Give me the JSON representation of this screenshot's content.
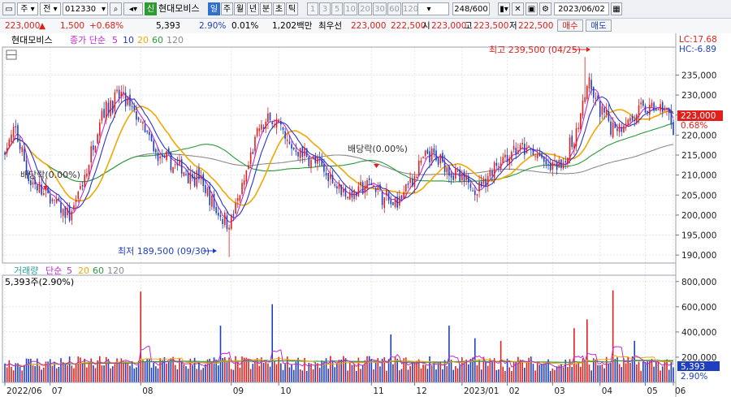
{
  "toolbar": {
    "market": "주",
    "mode": "전",
    "code": "012330",
    "type_badge": "신",
    "name": "현대모비스",
    "periods": [
      "일",
      "주",
      "월",
      "년",
      "분",
      "초",
      "틱"
    ],
    "active_period": "일",
    "intervals": [
      "1",
      "3",
      "5",
      "10",
      "20",
      "30",
      "60",
      "120"
    ],
    "count": "248",
    "count_max": "/600",
    "date": "2023/06/02"
  },
  "quote": {
    "price": "223,000",
    "arrow": "▲",
    "change": "1,500",
    "change_pct": "+0.68%",
    "volume": "5,393",
    "turnover": "2.90%",
    "ratio": "0.01%",
    "amount": "1,202백만",
    "best_label": "최우선",
    "best_ask": "223,000",
    "best_bid": "222,500",
    "open_label": "시",
    "open": "223,000",
    "high_label": "고",
    "high": "223,500",
    "low_label": "저",
    "low": "222,500",
    "buy_btn": "매수",
    "sell_btn": "매도"
  },
  "legend": {
    "name": "현대모비스",
    "ma_label": "종가 단순",
    "ma_periods": [
      "5",
      "10",
      "20",
      "60",
      "120"
    ],
    "vol_label": "거래량",
    "vol_ma_label": "단순",
    "vol_ma_periods": [
      "5",
      "20",
      "60",
      "120"
    ],
    "vol_current": "5,393주(2.90%)"
  },
  "colors": {
    "up": "#e0201c",
    "down": "#1f3fbf",
    "ma5": "#c02bd0",
    "ma10": "#2a34c8",
    "ma20": "#f0a800",
    "ma60": "#2a9a3a",
    "ma120": "#8c8c8c"
  },
  "chart_data": {
    "type": "candlestick",
    "price_axis": {
      "ticks": [
        "235,000",
        "230,000",
        "225,000",
        "220,000",
        "215,000",
        "210,000",
        "205,000",
        "200,000",
        "195,000",
        "190,000"
      ],
      "ylim": [
        188000,
        242000
      ]
    },
    "volume_axis": {
      "ticks": [
        "800,000",
        "600,000",
        "400,000",
        "200,000"
      ],
      "ylim": [
        0,
        850000
      ]
    },
    "x_labels": [
      "2022/06",
      "07",
      "08",
      "09",
      "10",
      "11",
      "12",
      "2023/01",
      "02",
      "03",
      "04",
      "05",
      "06"
    ],
    "lc": "LC:17.68",
    "hc": "HC:-6.89",
    "last_price": "223,000",
    "last_change": "0.68%",
    "last_volume": "5,393",
    "last_volume_pct": "2.90%",
    "annotations": {
      "high": "최고 239,500 (04/25)",
      "low": "최저 189,500 (09/30)",
      "dividend1": "배당락(0.00%)",
      "dividend2": "배당락(0.00%)"
    },
    "anchors": [
      [
        0,
        216000
      ],
      [
        5,
        221000
      ],
      [
        12,
        208000
      ],
      [
        20,
        205000
      ],
      [
        30,
        199000
      ],
      [
        38,
        211000
      ],
      [
        45,
        226000
      ],
      [
        54,
        230000
      ],
      [
        62,
        224000
      ],
      [
        70,
        215000
      ],
      [
        80,
        212000
      ],
      [
        90,
        209000
      ],
      [
        98,
        201000
      ],
      [
        104,
        198000
      ],
      [
        110,
        206000
      ],
      [
        118,
        222000
      ],
      [
        125,
        224000
      ],
      [
        132,
        217000
      ],
      [
        140,
        215000
      ],
      [
        150,
        210000
      ],
      [
        160,
        205000
      ],
      [
        170,
        208000
      ],
      [
        180,
        202000
      ],
      [
        190,
        210000
      ],
      [
        196,
        215000
      ],
      [
        204,
        213000
      ],
      [
        212,
        208000
      ],
      [
        220,
        207000
      ],
      [
        228,
        213000
      ],
      [
        236,
        216000
      ],
      [
        244,
        216000
      ],
      [
        252,
        212000
      ],
      [
        260,
        214000
      ],
      [
        266,
        222000
      ],
      [
        270,
        233000
      ],
      [
        276,
        226000
      ],
      [
        282,
        222000
      ],
      [
        290,
        224000
      ],
      [
        298,
        227000
      ],
      [
        306,
        226000
      ],
      [
        310,
        222000
      ]
    ],
    "vol_spikes": {
      "63": 720000,
      "124": 620000,
      "179": 380000,
      "206": 450000,
      "264": 430000,
      "282": 730000,
      "270": 500000,
      "100": 450000,
      "218": 350000,
      "230": 330000,
      "292": 330000
    }
  }
}
